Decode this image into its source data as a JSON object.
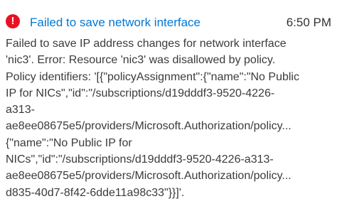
{
  "notification": {
    "icon": "error-icon",
    "icon_glyph": "!",
    "icon_color": "#e81123",
    "title": "Failed to save network interface",
    "title_color": "#0078d4",
    "time": "6:50 PM",
    "message_lines": [
      "Failed to save IP address changes for network interface",
      "'nic3'. Error: Resource 'nic3' was disallowed by policy.",
      "Policy identifiers: '[{\"policyAssignment\":{\"name\":\"No Public",
      "IP for NICs\",\"id\":\"/subscriptions/d19dddf3-9520-4226-",
      "a313-",
      "ae8ee08675e5/providers/Microsoft.Authorization/policy...",
      "{\"name\":\"No Public IP for",
      "NICs\",\"id\":\"/subscriptions/d19dddf3-9520-4226-a313-",
      "ae8ee08675e5/providers/Microsoft.Authorization/policy...",
      "d835-40d7-8f42-6dde11a98c33\"}}]'."
    ]
  }
}
